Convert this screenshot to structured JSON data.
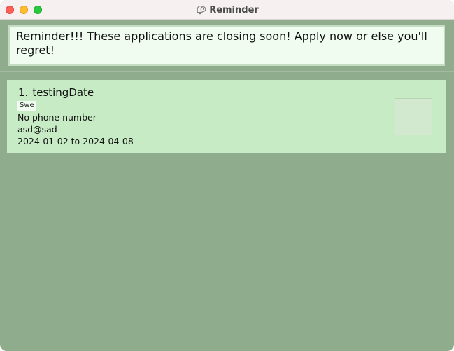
{
  "window": {
    "title": "Reminder",
    "title_icon": "bell-clock-icon"
  },
  "reminder": {
    "message": "Reminder!!! These applications are closing soon! Apply now or else you'll regret!"
  },
  "applications": [
    {
      "index": "1.",
      "name": "testingDate",
      "tag": "Swe",
      "phone": "No phone number",
      "email": "asd@sad",
      "dates": "2024-01-02 to 2024-04-08"
    }
  ],
  "colors": {
    "background": "#8fac8c",
    "card": "#c7ebc4",
    "message_box": "#effcef"
  }
}
